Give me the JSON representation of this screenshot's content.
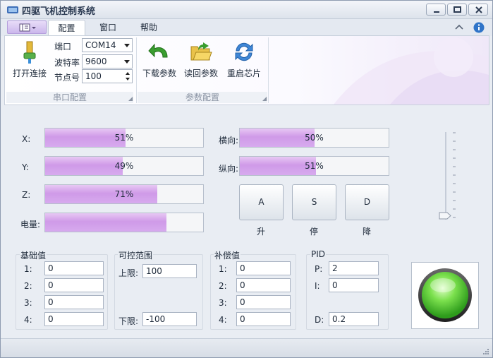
{
  "window": {
    "title": "四驱飞机控制系统"
  },
  "tabs": [
    {
      "label": "配置",
      "active": true
    },
    {
      "label": "窗口",
      "active": false
    },
    {
      "label": "帮助",
      "active": false
    }
  ],
  "ribbon": {
    "connect_label": "打开连接",
    "port_label": "端口",
    "port_value": "COM14",
    "baud_label": "波特率",
    "baud_value": "9600",
    "node_label": "节点号",
    "node_value": "100",
    "serial_group": "串口配置",
    "download_label": "下载参数",
    "readback_label": "读回参数",
    "restart_label": "重启芯片",
    "param_group": "参数配置"
  },
  "bars": {
    "x": {
      "label": "X:",
      "percent": 51,
      "text": "51%"
    },
    "y": {
      "label": "Y:",
      "percent": 49,
      "text": "49%"
    },
    "z": {
      "label": "Z:",
      "percent": 71,
      "text": "71%"
    },
    "power": {
      "label": "电量:",
      "percent": 77,
      "text": ""
    },
    "lateral": {
      "label": "横向:",
      "percent": 50,
      "text": "50%"
    },
    "longitudinal": {
      "label": "纵向:",
      "percent": 51,
      "text": "51%"
    }
  },
  "keys": [
    {
      "key": "A",
      "label": "升"
    },
    {
      "key": "S",
      "label": "停"
    },
    {
      "key": "D",
      "label": "降"
    }
  ],
  "slider": {
    "value_fraction": 0.05
  },
  "base": {
    "title": "基础值",
    "rows": [
      {
        "label": "1:",
        "value": "0"
      },
      {
        "label": "2:",
        "value": "0"
      },
      {
        "label": "3:",
        "value": "0"
      },
      {
        "label": "4:",
        "value": "0"
      }
    ]
  },
  "range": {
    "title": "可控范围",
    "upper_label": "上限:",
    "upper_value": "100",
    "lower_label": "下限:",
    "lower_value": "-100"
  },
  "compensation": {
    "title": "补偿值",
    "rows": [
      {
        "label": "1:",
        "value": "0"
      },
      {
        "label": "2:",
        "value": "0"
      },
      {
        "label": "3:",
        "value": "0"
      },
      {
        "label": "4:",
        "value": "0"
      }
    ]
  },
  "pid": {
    "title": "PID",
    "p_label": "P:",
    "p_value": "2",
    "i_label": "I:",
    "i_value": "0",
    "d_label": "D:",
    "d_value": "0.2"
  },
  "status_led": {
    "color": "#5fcf3a",
    "state": "on"
  },
  "colors": {
    "accent": "#cf9ae8",
    "window_bg": "#e9edf3"
  }
}
